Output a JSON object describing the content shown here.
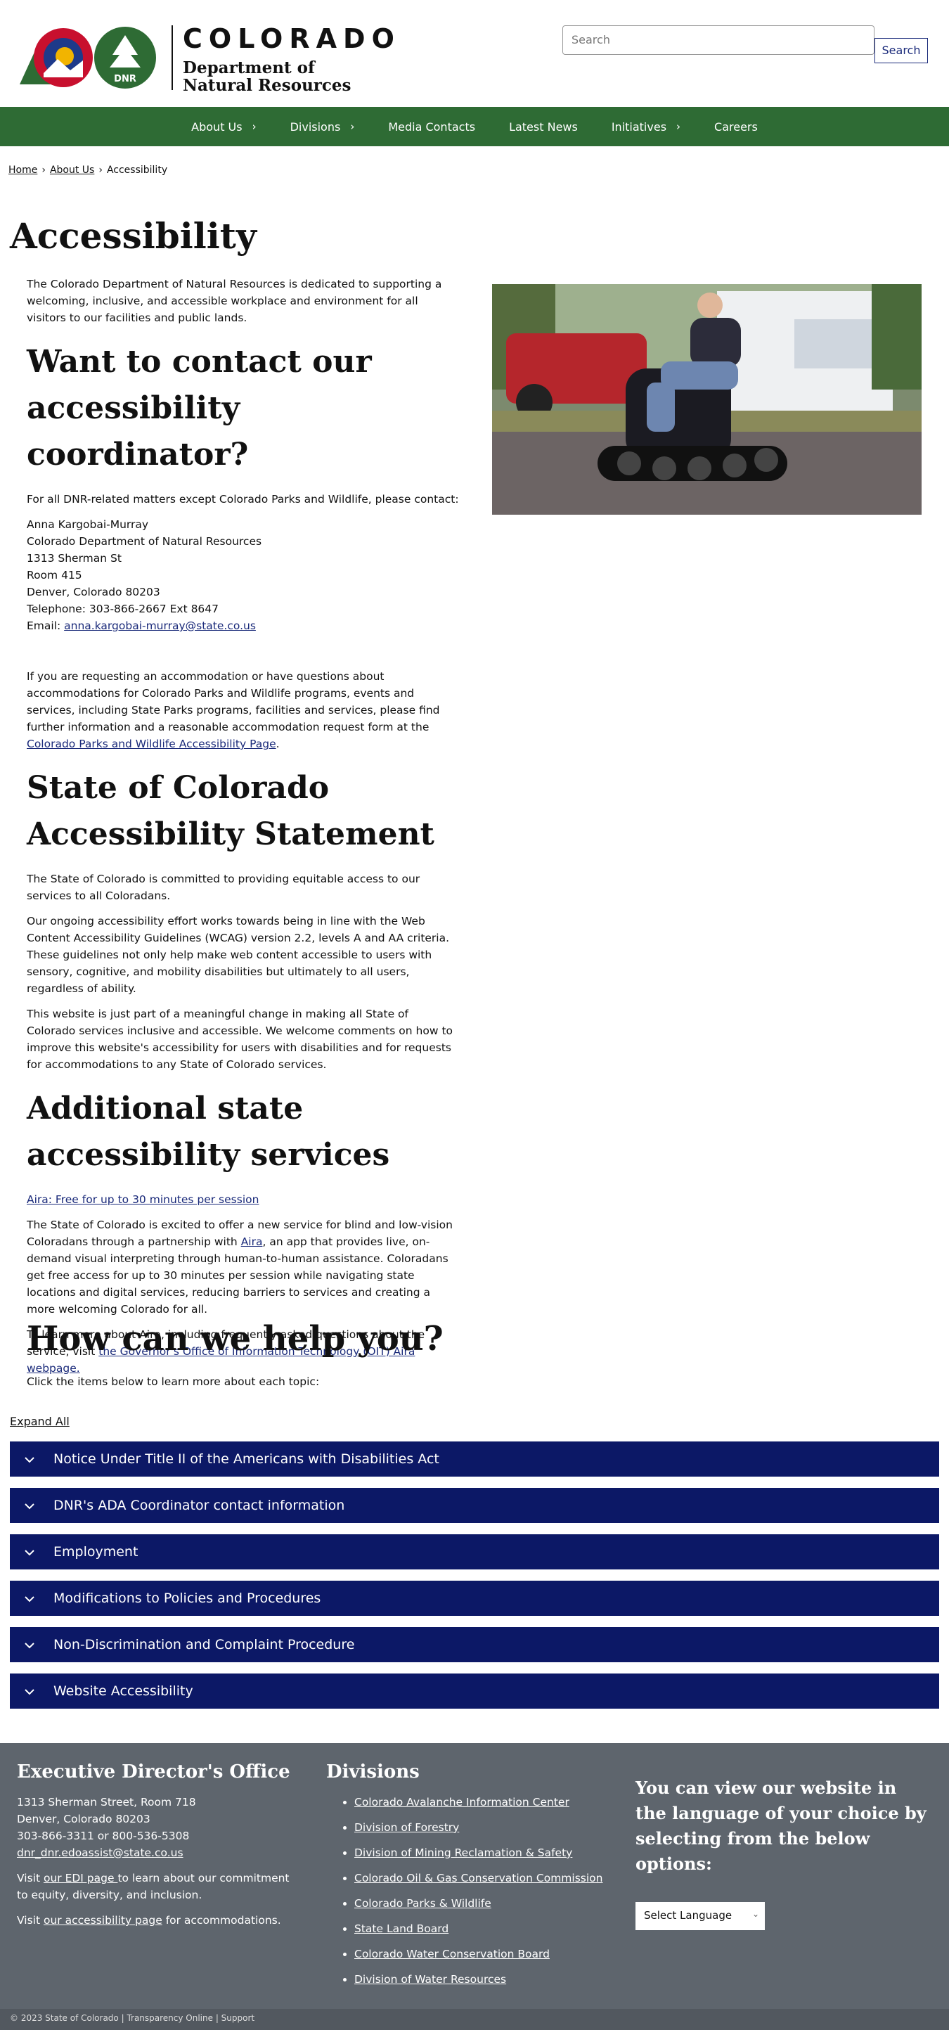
{
  "header": {
    "logo_word": "COLORADO",
    "logo_dept_line1": "Department of",
    "logo_dept_line2": "Natural Resources",
    "logo_badge": "DNR",
    "search_placeholder": "Search",
    "search_button": "Search"
  },
  "nav": {
    "items": [
      {
        "label": "About Us",
        "has_submenu": true
      },
      {
        "label": "Divisions",
        "has_submenu": true
      },
      {
        "label": "Media Contacts",
        "has_submenu": false
      },
      {
        "label": "Latest News",
        "has_submenu": false
      },
      {
        "label": "Initiatives",
        "has_submenu": true
      },
      {
        "label": "Careers",
        "has_submenu": false
      }
    ],
    "bg_color": "#2e6b34"
  },
  "breadcrumb": {
    "home": "Home",
    "about": "About Us",
    "current": "Accessibility",
    "sep": "›"
  },
  "page_title": "Accessibility",
  "intro": "The Colorado Department of Natural Resources is dedicated to supporting a welcoming, inclusive, and accessible workplace and environment for all  visitors to our facilities and public lands.",
  "coordinator": {
    "heading": "Want to contact our accessibility coordinator?",
    "lead": "For all DNR-related matters except Colorado Parks and Wildlife, please contact:",
    "name": "Anna Kargobai-Murray",
    "org": "Colorado Department of Natural Resources",
    "street": "1313 Sherman St",
    "room": "Room 415",
    "city": "Denver, Colorado 80203",
    "phone": "Telephone: 303-866-2667 Ext 8647",
    "email_label": "Email: ",
    "email": "anna.kargobai-murray@state.co.us",
    "cpw_text_before": "If you are requesting an accommodation or have questions about accommodations for Colorado Parks and Wildlife programs, events and services, including State Parks programs, facilities and services, please find further information and a reasonable accommodation request form at the ",
    "cpw_link": "Colorado Parks and Wildlife Accessibility Page",
    "cpw_text_after": "."
  },
  "statement": {
    "heading": "State of Colorado Accessibility Statement",
    "p1": "The State of Colorado is committed to providing equitable access to our services to all Coloradans.",
    "p2": "Our ongoing accessibility effort works towards being in line with the Web Content Accessibility Guidelines (WCAG) version 2.2, levels A and AA criteria. These guidelines not only help make web content accessible to users with sensory, cognitive, and mobility disabilities but ultimately to all users, regardless of ability.",
    "p3": "This website is just part of a meaningful change in making all State of Colorado services inclusive and accessible. We welcome comments on how to improve this website's accessibility for users with disabilities and for requests for accommodations to any State of Colorado services."
  },
  "additional": {
    "heading": "Additional state accessibility services",
    "aira_link": "Aira: Free for up to 30 minutes per session",
    "p1_before": "The State of Colorado is excited to offer a new service for blind and low-vision Coloradans through a partnership with ",
    "p1_link": "Aira",
    "p1_after": ", an app that provides live, on-demand visual interpreting through human-to-human assistance. Coloradans get free access for up to 30 minutes per session while navigating state locations and digital services, reducing barriers to services and creating a more welcoming Colorado for all.",
    "p2_before": "To learn more about Aira, including frequently asked questions about the service, visit ",
    "p2_link": "the Governor's Office of Information Technology (OIT) Aira webpage."
  },
  "help": {
    "heading": "How can we help you?",
    "sub": "Click the items below to learn more about each topic:",
    "expand_all": "Expand All",
    "items": [
      "Notice Under Title II of the Americans with Disabilities Act",
      "DNR's ADA Coordinator contact information",
      "Employment",
      "Modifications to Policies and Procedures",
      "Non-Discrimination and Complaint Procedure",
      "Website Accessibility"
    ],
    "accent": "#0c1866"
  },
  "footer": {
    "office_heading": "Executive Director's Office",
    "office_street": "1313 Sherman Street, Room 718",
    "office_city": "Denver, Colorado 80203",
    "office_phone": "303-866-3311 or 800-536-5308",
    "office_email": "dnr_dnr.edoassist@state.co.us",
    "edi_before": "Visit ",
    "edi_link": "our EDI page ",
    "edi_after": "to learn about our commitment to equity, diversity, and inclusion.",
    "acc_before": "Visit ",
    "acc_link": "our accessibility page",
    "acc_after": " for accommodations.",
    "divisions_heading": "Divisions",
    "divisions": [
      "Colorado Avalanche Information Center",
      "Division of Forestry",
      "Division of Mining Reclamation & Safety",
      "Colorado Oil & Gas Conservation Commission",
      "Colorado Parks & Wildlife",
      "State Land Board",
      "Colorado Water Conservation Board",
      "Division of Water Resources"
    ],
    "language_text": "You can view our website in the language of your choice by selecting from the below options:",
    "language_select": "Select Language",
    "bottom_text": "© 2023 State of Colorado  |  Transparency Online  |  Support",
    "bg_color": "#5e656d"
  }
}
